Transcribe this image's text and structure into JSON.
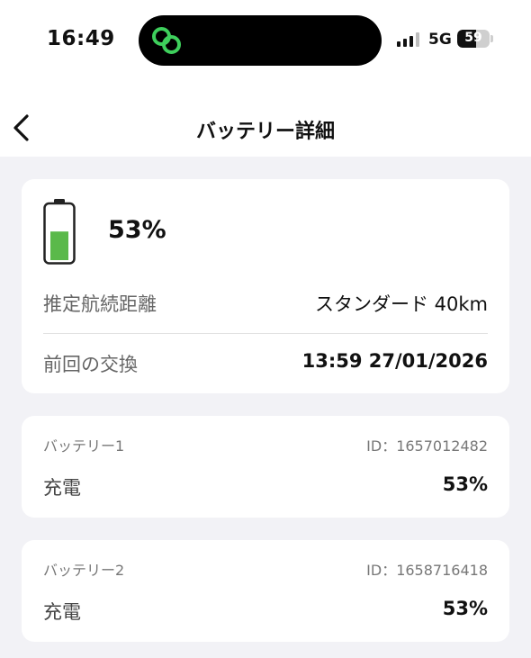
{
  "status_bar": {
    "time": "16:49",
    "network": "5G",
    "battery_text": "59",
    "battery_level": 0.59,
    "signal_bars_active": 3,
    "signal_bars_total": 4,
    "island_icon": "link-icon",
    "island_icon_color": "#3ecf5c"
  },
  "nav": {
    "back_icon": "chevron-left-icon",
    "title": "バッテリー詳細"
  },
  "summary": {
    "battery_icon": "battery-icon",
    "battery_fill_color": "#5ab94a",
    "level": 0.53,
    "percent": "53%",
    "range_label": "推定航続距離",
    "range_value": "スタンダード 40km",
    "last_swap_label": "前回の交換",
    "last_swap_value": "13:59 27/01/2026"
  },
  "batteries": [
    {
      "name": "バッテリー1",
      "id": "ID：1657012482",
      "status_label": "充電",
      "status_value": "53%"
    },
    {
      "name": "バッテリー2",
      "id": "ID：1658716418",
      "status_label": "充電",
      "status_value": "53%"
    }
  ]
}
